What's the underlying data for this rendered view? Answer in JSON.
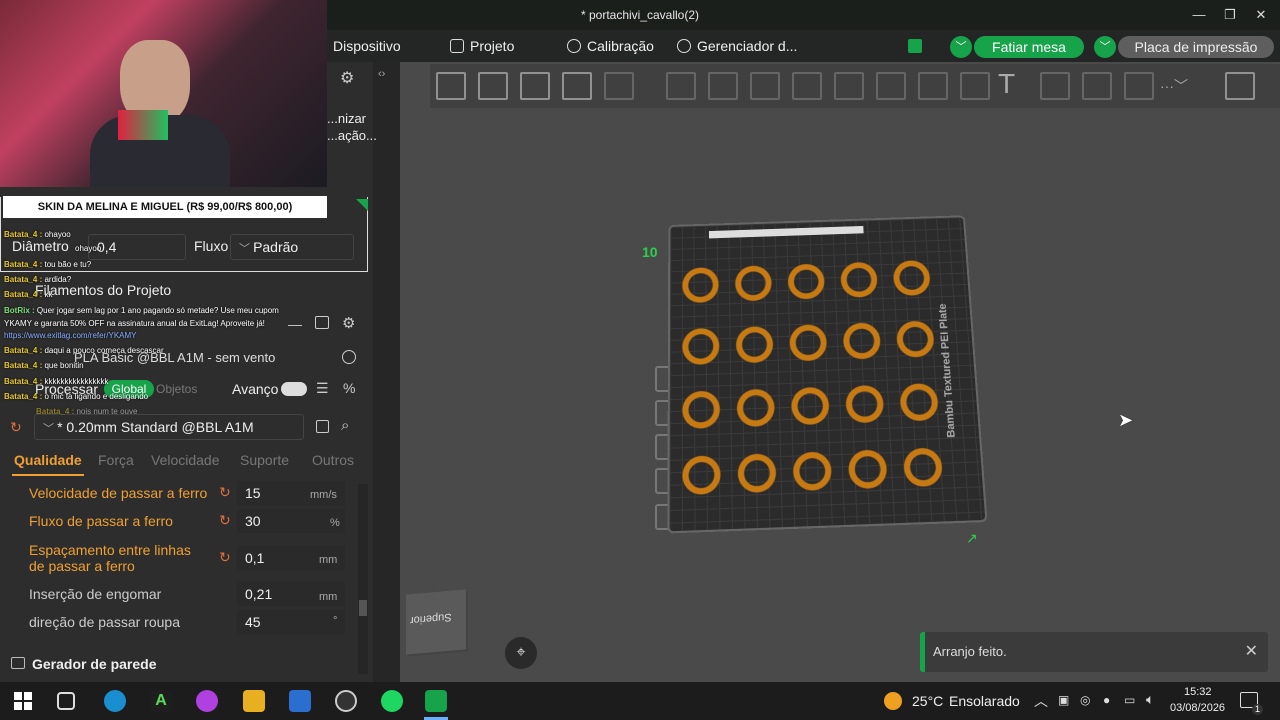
{
  "window": {
    "title": "* portachivi_cavallo(2)"
  },
  "menu": {
    "device": "Dispositivo",
    "project": "Projeto",
    "calibration": "Calibração",
    "manager": "Gerenciador d...",
    "slice_plate": "Fatiar mesa",
    "print_plate": "Placa de impressão"
  },
  "stream": {
    "banner": "SKIN DA MELINA E MIGUEL (R$ 99,00/R$ 800,00)",
    "chat": [
      {
        "user": "Batata_4 :",
        "text": "ohayoo"
      },
      {
        "user": "",
        "text": "ohayoo"
      },
      {
        "user": "Batata_4 :",
        "text": "tou bão e tu?"
      },
      {
        "user": "Batata_4 :",
        "text": "ardida?"
      },
      {
        "user": "Batata_4 :",
        "text": "kk"
      },
      {
        "user": "BotRix :",
        "text": "Quer jogar sem lag por 1 ano pagando só metade? Use meu cupom"
      },
      {
        "user": "",
        "text": "YKAMY e garanta 50% OFF na assinatura anual da ExitLag! Aproveite já!"
      },
      {
        "user": "",
        "text": "https://www.exitlag.com/refer/YKAMY"
      },
      {
        "user": "Batata_4 :",
        "text": "daqui a pouco começa descascar"
      },
      {
        "user": "Batata_4 :",
        "text": "que bonitin"
      },
      {
        "user": "Batata_4 :",
        "text": "kkkkkkkkkkkkkkkk"
      },
      {
        "user": "Batata_4 :",
        "text": "o mic ta ligando e desligando"
      },
      {
        "user": "Batata_4 :",
        "text": "nois num te ouve"
      }
    ]
  },
  "left": {
    "organize": "...nizar\n...ação...",
    "diameter_label": "Diâmetro",
    "diameter_value": "0,4",
    "flow_label": "Fluxo",
    "flow_value": "Padrão",
    "filaments_title": "Filamentos do Projeto",
    "filament_value": "PLA Basic @BBL A1M - sem vento",
    "process_label": "Processar",
    "global_label": "Global",
    "objects_label": "Objetos",
    "advanced_label": "Avanço",
    "profile_value": "* 0.20mm Standard @BBL A1M",
    "tabs": [
      "Qualidade",
      "Força",
      "Velocidade",
      "Suporte",
      "Outros"
    ],
    "params": [
      {
        "label": "Velocidade de passar a ferro",
        "value": "15",
        "unit": "mm/s",
        "modified": true
      },
      {
        "label": "Fluxo de passar a ferro",
        "value": "30",
        "unit": "%",
        "modified": true
      },
      {
        "label": "Espaçamento entre linhas\nde passar a ferro",
        "value": "0,1",
        "unit": "mm",
        "modified": true
      },
      {
        "label": "Inserção de engomar",
        "value": "0,21",
        "unit": "mm",
        "modified": false
      },
      {
        "label": "direção de passar roupa",
        "value": "45",
        "unit": "°",
        "modified": false
      }
    ],
    "wall_generator": "Gerador de parede"
  },
  "viewport": {
    "plate_label": "Bambu Textured PEI Plate",
    "plate_number": "10",
    "view_cube_label": "Superior",
    "notification": "Arranjo feito."
  },
  "taskbar": {
    "weather_temp": "25°C",
    "weather_desc": "Ensolarado",
    "time": "15:32",
    "date": "03/08/2026",
    "notif_count": "1"
  },
  "colors": {
    "accent": "#16a34a",
    "orange": "#f0a032",
    "part": "#c77a12",
    "modified": "#e07040"
  }
}
